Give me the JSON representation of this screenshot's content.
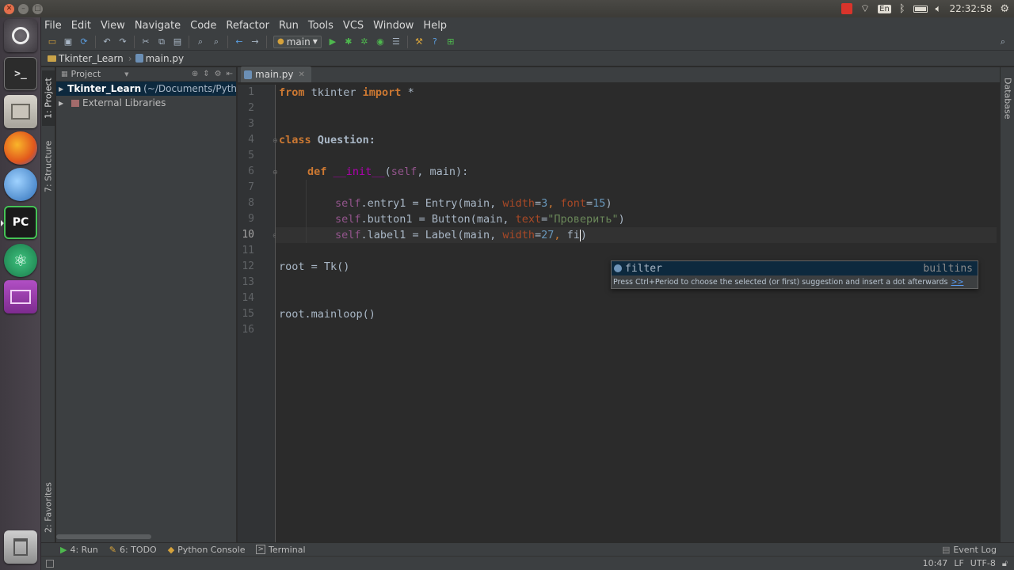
{
  "panel": {
    "lang": "En",
    "time": "22:32:58"
  },
  "menu": [
    "File",
    "Edit",
    "View",
    "Navigate",
    "Code",
    "Refactor",
    "Run",
    "Tools",
    "VCS",
    "Window",
    "Help"
  ],
  "toolbar": {
    "run_config": "main"
  },
  "navbar": {
    "project": "Tkinter_Learn",
    "file": "main.py"
  },
  "left_tabs": {
    "project": "1: Project",
    "structure": "7: Structure",
    "favorites": "2: Favorites"
  },
  "right_tabs": {
    "database": "Database"
  },
  "project_panel": {
    "header": "Project",
    "root_name": "Tkinter_Learn",
    "root_path": "(~/Documents/Pytho",
    "libraries": "External Libraries"
  },
  "editor": {
    "tab": "main.py",
    "line_numbers": [
      "1",
      "2",
      "3",
      "4",
      "5",
      "6",
      "7",
      "8",
      "9",
      "10",
      "11",
      "12",
      "13",
      "14",
      "15",
      "16"
    ],
    "code": {
      "l1_from": "from",
      "l1_mod": " tkinter ",
      "l1_import": "import",
      "l1_rest": " *",
      "l4_class": "class",
      "l4_name": " Question:",
      "l6_def": "def",
      "l6_init": "__init__",
      "l6_open": "(",
      "l6_self": "self",
      "l6_rest": ", main):",
      "l8_self": "self",
      "l8_a": ".entry1 = Entry(main, ",
      "l8_p1": "width",
      "l8_e1": "=",
      "l8_n1": "3",
      "l8_c": ", ",
      "l8_p2": "font",
      "l8_e2": "=",
      "l8_n2": "15",
      "l8_end": ")",
      "l9_self": "self",
      "l9_a": ".button1 = Button(main, ",
      "l9_p1": "text",
      "l9_e1": "=",
      "l9_s": "\"Проверить\"",
      "l9_end": ")",
      "l10_self": "self",
      "l10_a": ".label1 = Label(main, ",
      "l10_p1": "width",
      "l10_e1": "=",
      "l10_n1": "27",
      "l10_c": ", ",
      "l10_typed": "fi",
      "l10_end": ")",
      "l12": "root = Tk()",
      "l15": "root.mainloop()"
    }
  },
  "completion": {
    "item": "filter",
    "type": "builtins",
    "hint": "Press Ctrl+Period to choose the selected (or first) suggestion and insert a dot afterwards",
    "hint_link": ">>"
  },
  "bottom_tools": {
    "run": "4: Run",
    "todo": "6: TODO",
    "console": "Python Console",
    "terminal": "Terminal",
    "event_log": "Event Log"
  },
  "status": {
    "position": "10:47",
    "line_sep": "LF",
    "encoding": "UTF-8"
  },
  "colors": {
    "editor_bg": "#2b2b2b",
    "keyword": "#cc7832",
    "string": "#6a8759",
    "number": "#6897bb",
    "self": "#94558d"
  }
}
